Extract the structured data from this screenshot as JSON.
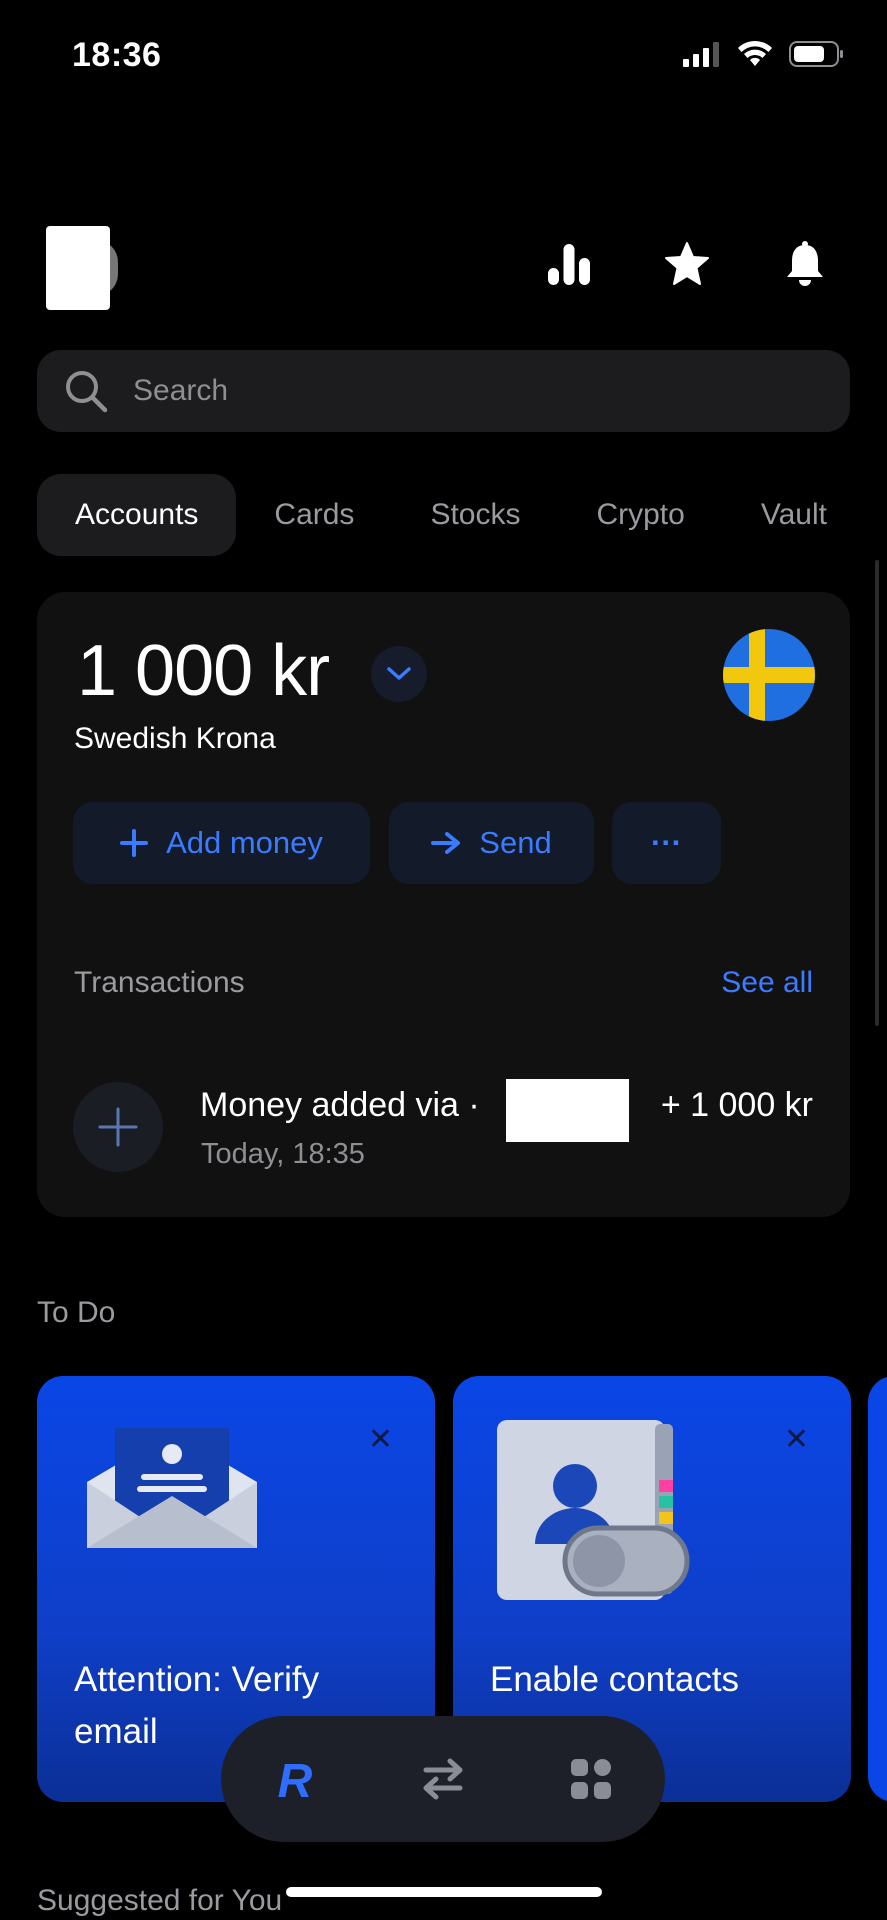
{
  "status_bar": {
    "time": "18:36"
  },
  "search": {
    "placeholder": "Search"
  },
  "tabs": [
    {
      "label": "Accounts",
      "active": true
    },
    {
      "label": "Cards"
    },
    {
      "label": "Stocks"
    },
    {
      "label": "Crypto"
    },
    {
      "label": "Vault"
    }
  ],
  "account": {
    "balance": "1 000 kr",
    "currency_name": "Swedish Krona",
    "actions": {
      "add_money": "Add money",
      "send": "Send",
      "more": "···"
    },
    "transactions_label": "Transactions",
    "see_all": "See all",
    "transactions": [
      {
        "title": "Money added via ·",
        "amount": "+ 1 000 kr",
        "time": "Today, 18:35"
      }
    ]
  },
  "todo": {
    "title": "To Do",
    "cards": [
      {
        "label_line1": "Attention: Verify",
        "label_line2": "email",
        "close": "✕"
      },
      {
        "label_line1": "Enable contacts",
        "close": "✕"
      }
    ]
  },
  "suggested": {
    "title": "Suggested for You"
  },
  "colors": {
    "accent": "#3a7bff",
    "background": "#000000",
    "card": "#111112",
    "todo_blue": "#0a46e6"
  },
  "icons": [
    "analytics-icon",
    "star-icon",
    "bell-icon",
    "search-icon",
    "chevron-down-icon",
    "sweden-flag-icon",
    "plus-icon",
    "arrow-right-icon",
    "revolut-r-icon",
    "transfer-icon",
    "apps-grid-icon"
  ]
}
